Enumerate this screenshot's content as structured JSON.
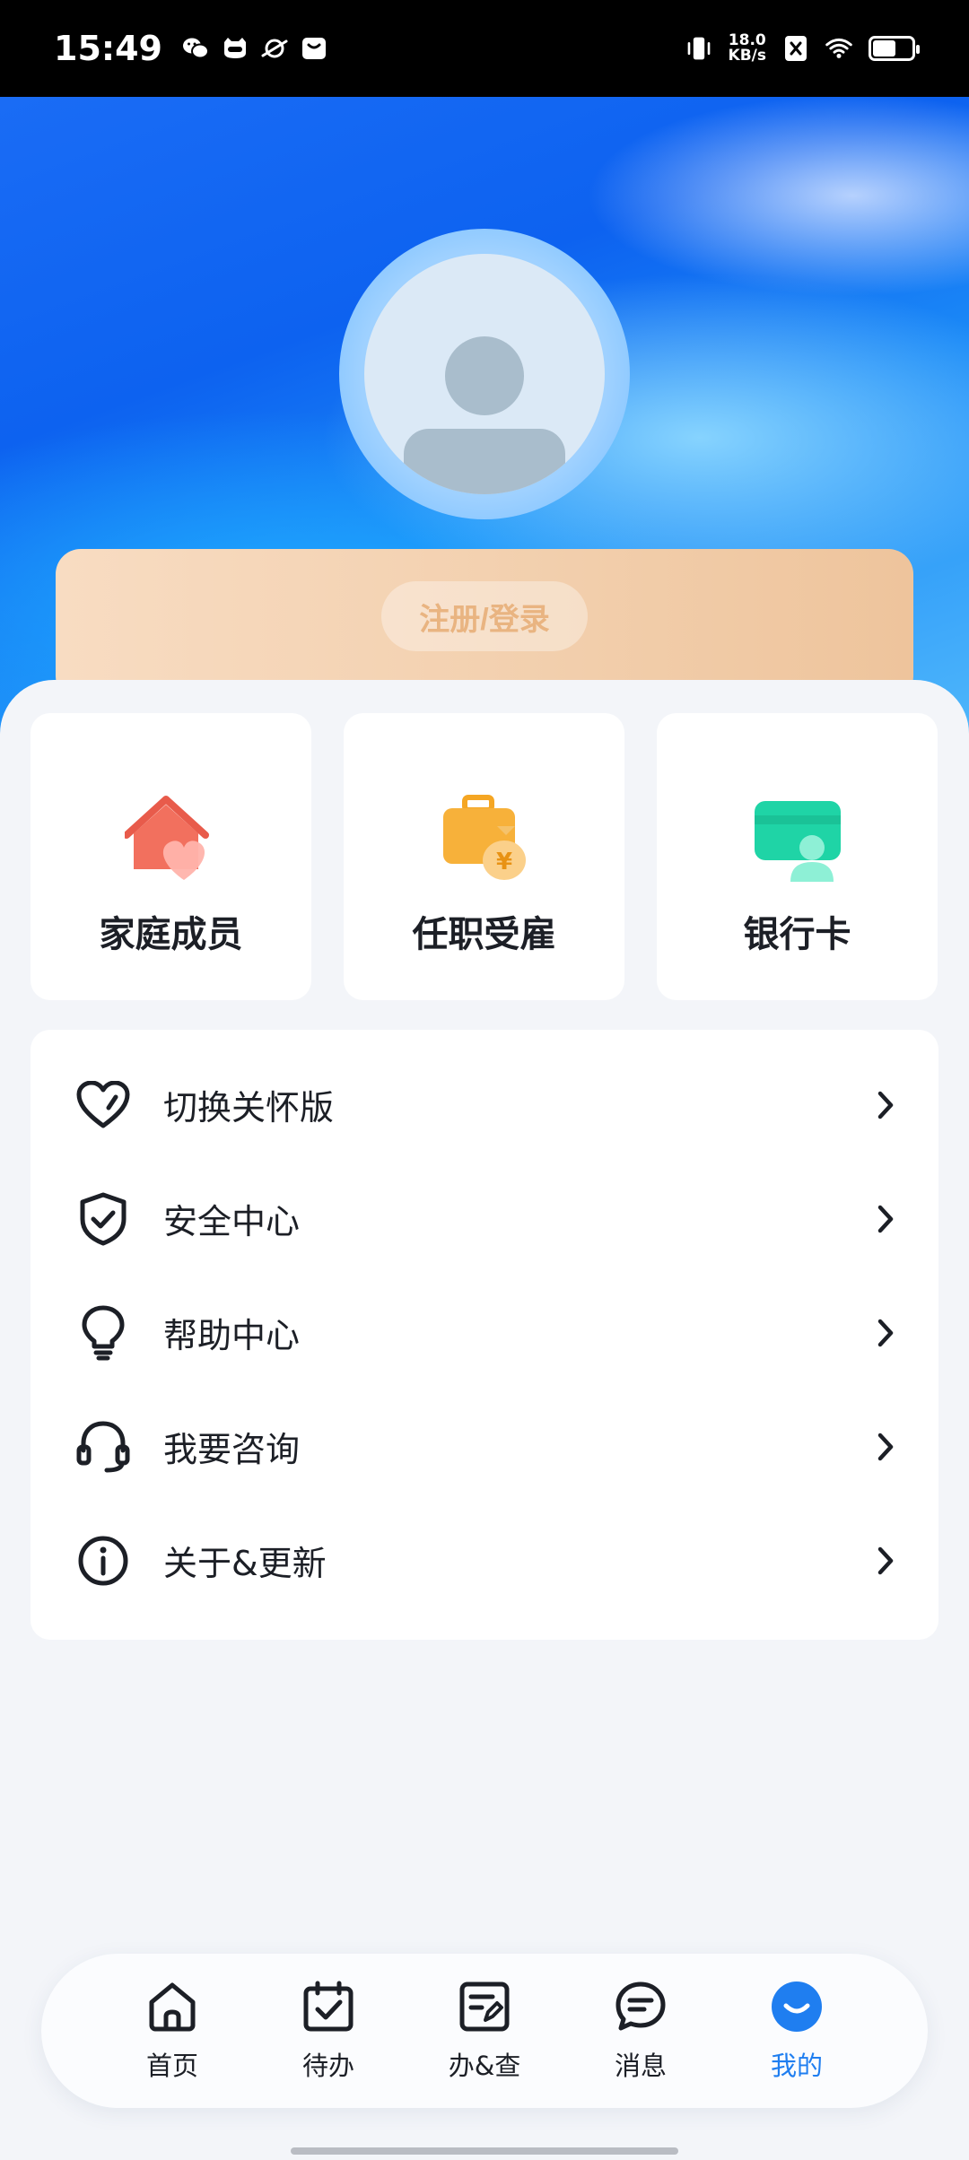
{
  "status_bar": {
    "time": "15:49",
    "net_speed_value": "18.0",
    "net_speed_unit": "KB/s",
    "icons": [
      "wechat-icon",
      "cat-icon",
      "planet-icon",
      "bag-icon",
      "vibrate-icon",
      "sim-off-icon",
      "wifi-icon",
      "battery-icon"
    ]
  },
  "profile": {
    "login_label": "注册/登录"
  },
  "shortcuts": [
    {
      "label": "家庭成员",
      "icon": "family-house-icon",
      "color": "#f06a5a"
    },
    {
      "label": "任职受雇",
      "icon": "briefcase-money-icon",
      "color": "#f5a623"
    },
    {
      "label": "银行卡",
      "icon": "bank-card-icon",
      "color": "#1ed6a8"
    }
  ],
  "menu": [
    {
      "label": "切换关怀版",
      "icon": "heart-icon"
    },
    {
      "label": "安全中心",
      "icon": "shield-check-icon"
    },
    {
      "label": "帮助中心",
      "icon": "lightbulb-icon"
    },
    {
      "label": "我要咨询",
      "icon": "headset-icon"
    },
    {
      "label": "关于&更新",
      "icon": "info-icon"
    }
  ],
  "bottom_nav": [
    {
      "label": "首页",
      "icon": "home-icon",
      "active": false
    },
    {
      "label": "待办",
      "icon": "calendar-check-icon",
      "active": false
    },
    {
      "label": "办&查",
      "icon": "form-edit-icon",
      "active": false
    },
    {
      "label": "消息",
      "icon": "message-icon",
      "active": false
    },
    {
      "label": "我的",
      "icon": "smile-icon",
      "active": true
    }
  ],
  "colors": {
    "accent": "#1f7ef0",
    "login_text": "#e9b481"
  }
}
